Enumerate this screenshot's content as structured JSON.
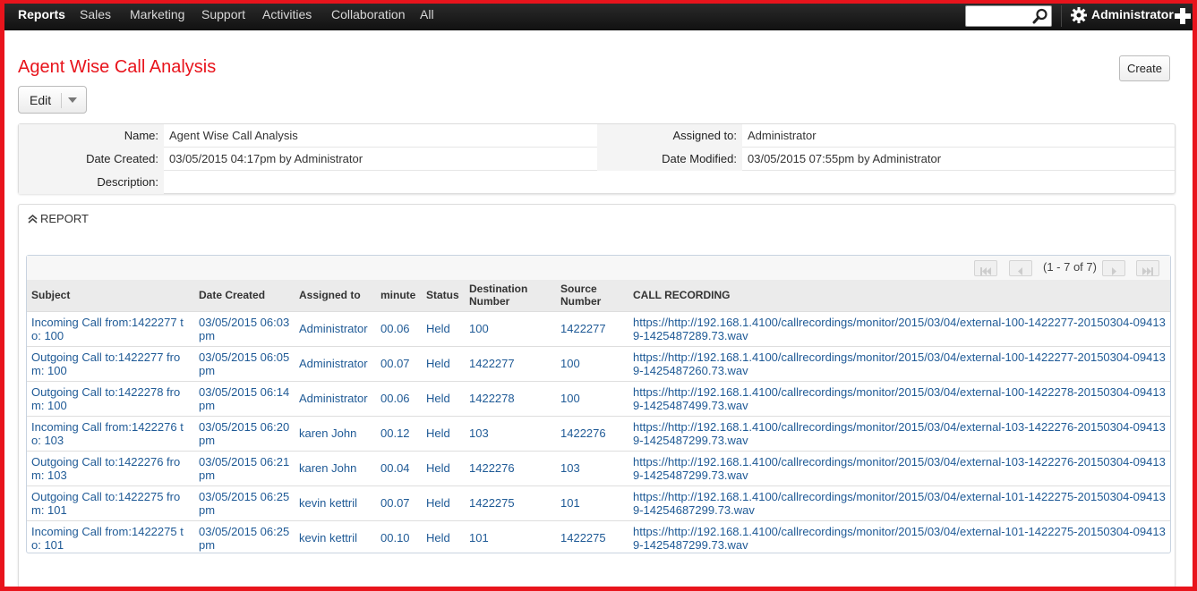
{
  "nav": {
    "items": [
      "Reports",
      "Sales",
      "Marketing",
      "Support",
      "Activities",
      "Collaboration",
      "All"
    ],
    "active": "Reports",
    "user": "Administrator"
  },
  "page": {
    "title": "Agent Wise Call Analysis",
    "create_label": "Create",
    "edit_label": "Edit"
  },
  "details": {
    "name_label": "Name:",
    "name_value": "Agent Wise Call Analysis",
    "assigned_label": "Assigned to:",
    "assigned_value": "Administrator",
    "created_label": "Date Created:",
    "created_value": "03/05/2015 04:17pm by Administrator",
    "modified_label": "Date Modified:",
    "modified_value": "03/05/2015 07:55pm by Administrator",
    "description_label": "Description:",
    "description_value": ""
  },
  "report": {
    "header": "REPORT",
    "pager_text": "(1 - 7 of 7)",
    "columns": [
      "Subject",
      "Date Created",
      "Assigned to",
      "minute",
      "Status",
      "Destination Number",
      "Source Number",
      "CALL RECORDING"
    ],
    "rows": [
      [
        "Incoming Call from:1422277 to: 100",
        "03/05/2015 06:03pm",
        "Administrator",
        "00.06",
        "Held",
        "100",
        "1422277",
        "https://http://192.168.1.4100/callrecordings/monitor/2015/03/04/external-100-1422277-20150304-094139-1425487289.73.wav"
      ],
      [
        "Outgoing Call to:1422277 from: 100",
        "03/05/2015 06:05pm",
        "Administrator",
        "00.07",
        "Held",
        "1422277",
        "100",
        "https://http://192.168.1.4100/callrecordings/monitor/2015/03/04/external-100-1422277-20150304-094139-1425487260.73.wav"
      ],
      [
        "Outgoing Call to:1422278 from: 100",
        "03/05/2015 06:14pm",
        "Administrator",
        "00.06",
        "Held",
        "1422278",
        "100",
        "https://http://192.168.1.4100/callrecordings/monitor/2015/03/04/external-100-1422278-20150304-094139-1425487499.73.wav"
      ],
      [
        "Incoming Call from:1422276 to: 103",
        "03/05/2015 06:20pm",
        "karen John",
        "00.12",
        "Held",
        "103",
        "1422276",
        "https://http://192.168.1.4100/callrecordings/monitor/2015/03/04/external-103-1422276-20150304-094139-1425487299.73.wav"
      ],
      [
        "Outgoing Call to:1422276 from: 103",
        "03/05/2015 06:21pm",
        "karen John",
        "00.04",
        "Held",
        "1422276",
        "103",
        "https://http://192.168.1.4100/callrecordings/monitor/2015/03/04/external-103-1422276-20150304-094139-1425487299.73.wav"
      ],
      [
        "Outgoing Call to:1422275 from: 101",
        "03/05/2015 06:25pm",
        "kevin kettril",
        "00.07",
        "Held",
        "1422275",
        "101",
        "https://http://192.168.1.4100/callrecordings/monitor/2015/03/04/external-101-1422275-20150304-094139-14254687299.73.wav"
      ],
      [
        "Incoming Call from:1422275 to: 101",
        "03/05/2015 06:25pm",
        "kevin kettril",
        "00.10",
        "Held",
        "101",
        "1422275",
        "https://http://192.168.1.4100/callrecordings/monitor/2015/03/04/external-101-1422275-20150304-094139-1425487299.73.wav"
      ]
    ]
  },
  "colors": {
    "brand_red": "#e8141c",
    "link_blue": "#1f5a96",
    "nav_bg": "#1a1a1a"
  },
  "icons": [
    "search-icon",
    "gear-icon",
    "plus-icon",
    "caret-down-icon",
    "collapse-icon",
    "first-page-icon",
    "prev-page-icon",
    "next-page-icon",
    "last-page-icon"
  ]
}
